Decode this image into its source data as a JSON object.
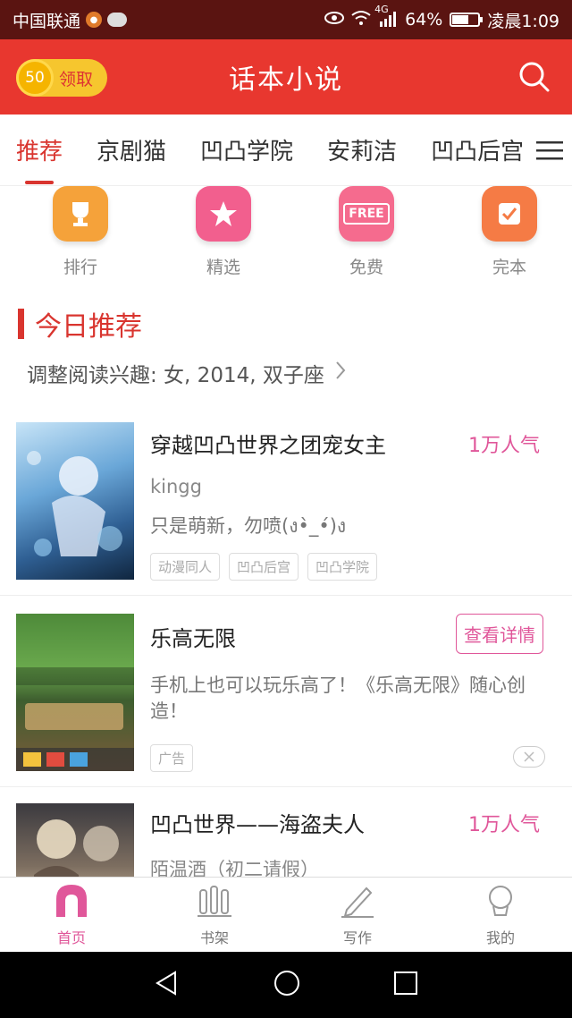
{
  "status_bar": {
    "carrier": "中国联通",
    "network": "4G",
    "battery": "64%",
    "battery_level": 0.64,
    "time": "凌晨1:09"
  },
  "app_bar": {
    "coin_value": "50",
    "coin_label": "领取",
    "title": "话本小说",
    "search_icon": "search-icon"
  },
  "tabs": [
    {
      "label": "推荐",
      "active": true
    },
    {
      "label": "京剧猫"
    },
    {
      "label": "凹凸学院"
    },
    {
      "label": "安莉洁"
    },
    {
      "label": "凹凸后宫"
    }
  ],
  "quick_links": [
    {
      "label": "排行",
      "icon": "trophy-icon",
      "color": "#f5a23a"
    },
    {
      "label": "精选",
      "icon": "star-icon",
      "color": "#f25f8e"
    },
    {
      "label": "免费",
      "icon": "free-icon",
      "color": "#f56b8e",
      "icon_text": "FREE"
    },
    {
      "label": "完本",
      "icon": "check-icon",
      "color": "#f57b45"
    }
  ],
  "section": {
    "title": "今日推荐",
    "interest": "调整阅读兴趣: 女, 2014, 双子座"
  },
  "books": [
    {
      "title": "穿越凹凸世界之团宠女主",
      "popularity": "1万人气",
      "author": "kingg",
      "desc": "只是萌新，勿喷(ง•̀_•́)ง",
      "tags": [
        "动漫同人",
        "凹凸后宫",
        "凹凸学院"
      ]
    },
    {
      "title": "乐高无限",
      "button": "查看详情",
      "desc": "手机上也可以玩乐高了！《乐高无限》随心创造！",
      "ad_tag": "广告"
    },
    {
      "title": "凹凸世界——海盗夫人",
      "popularity": "1万人气",
      "author": "陌温酒（初二请假）"
    }
  ],
  "bottom_nav": [
    {
      "label": "首页",
      "icon": "home-icon",
      "active": true
    },
    {
      "label": "书架",
      "icon": "bookshelf-icon"
    },
    {
      "label": "写作",
      "icon": "pen-icon"
    },
    {
      "label": "我的",
      "icon": "profile-icon"
    }
  ],
  "colors": {
    "status_bar": "#5a1411",
    "app_bar": "#e8372f",
    "accent": "#d9352f",
    "pink": "#e0579a"
  }
}
